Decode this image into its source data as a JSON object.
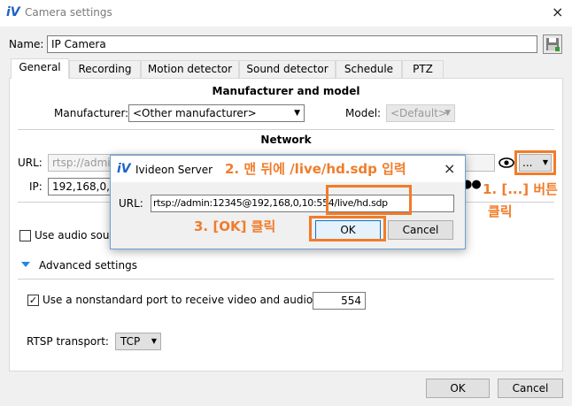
{
  "window": {
    "logo": "iV",
    "title": "Camera settings",
    "close_icon": "×"
  },
  "name_field": {
    "label": "Name:",
    "value": "IP Camera"
  },
  "tabs": [
    {
      "label": "General"
    },
    {
      "label": "Recording"
    },
    {
      "label": "Motion detector"
    },
    {
      "label": "Sound detector"
    },
    {
      "label": "Schedule"
    },
    {
      "label": "PTZ"
    }
  ],
  "manufacturer_section": {
    "title": "Manufacturer and model",
    "manufacturer_label": "Manufacturer:",
    "manufacturer_value": "<Other manufacturer>",
    "model_label": "Model:",
    "model_value": "<Default>"
  },
  "network_section": {
    "title": "Network",
    "url_label": "URL:",
    "url_value": "rtsp://admi",
    "ip_label": "IP:",
    "ip_value": "192,168,0,1(",
    "password_dots": "●●",
    "more_button": "...",
    "dropdown_icon": "▼"
  },
  "audio_checkbox_label": "Use audio sou",
  "advanced_settings": {
    "label": "Advanced settings"
  },
  "nonstandard_port": {
    "label": "Use a nonstandard port to receive video and audio:",
    "checked": true,
    "value": "554"
  },
  "rtsp_transport": {
    "label": "RTSP transport:",
    "value": "TCP"
  },
  "footer": {
    "ok": "OK",
    "cancel": "Cancel"
  },
  "dialog": {
    "logo": "iV",
    "title": "Ivideon Server",
    "url_label": "URL:",
    "url_value": "rtsp://admin:12345@192,168,0,10:554/live/hd.sdp",
    "ok": "OK",
    "cancel": "Cancel",
    "close_icon": "×"
  },
  "annotations": {
    "step1_line1": "1. [...] 버튼",
    "step1_line2": "클릭",
    "step2": "2. 맨 뒤에 /live/hd.sdp 입력",
    "step3": "3. [OK] 클릭",
    "color": "#f07c2a"
  }
}
